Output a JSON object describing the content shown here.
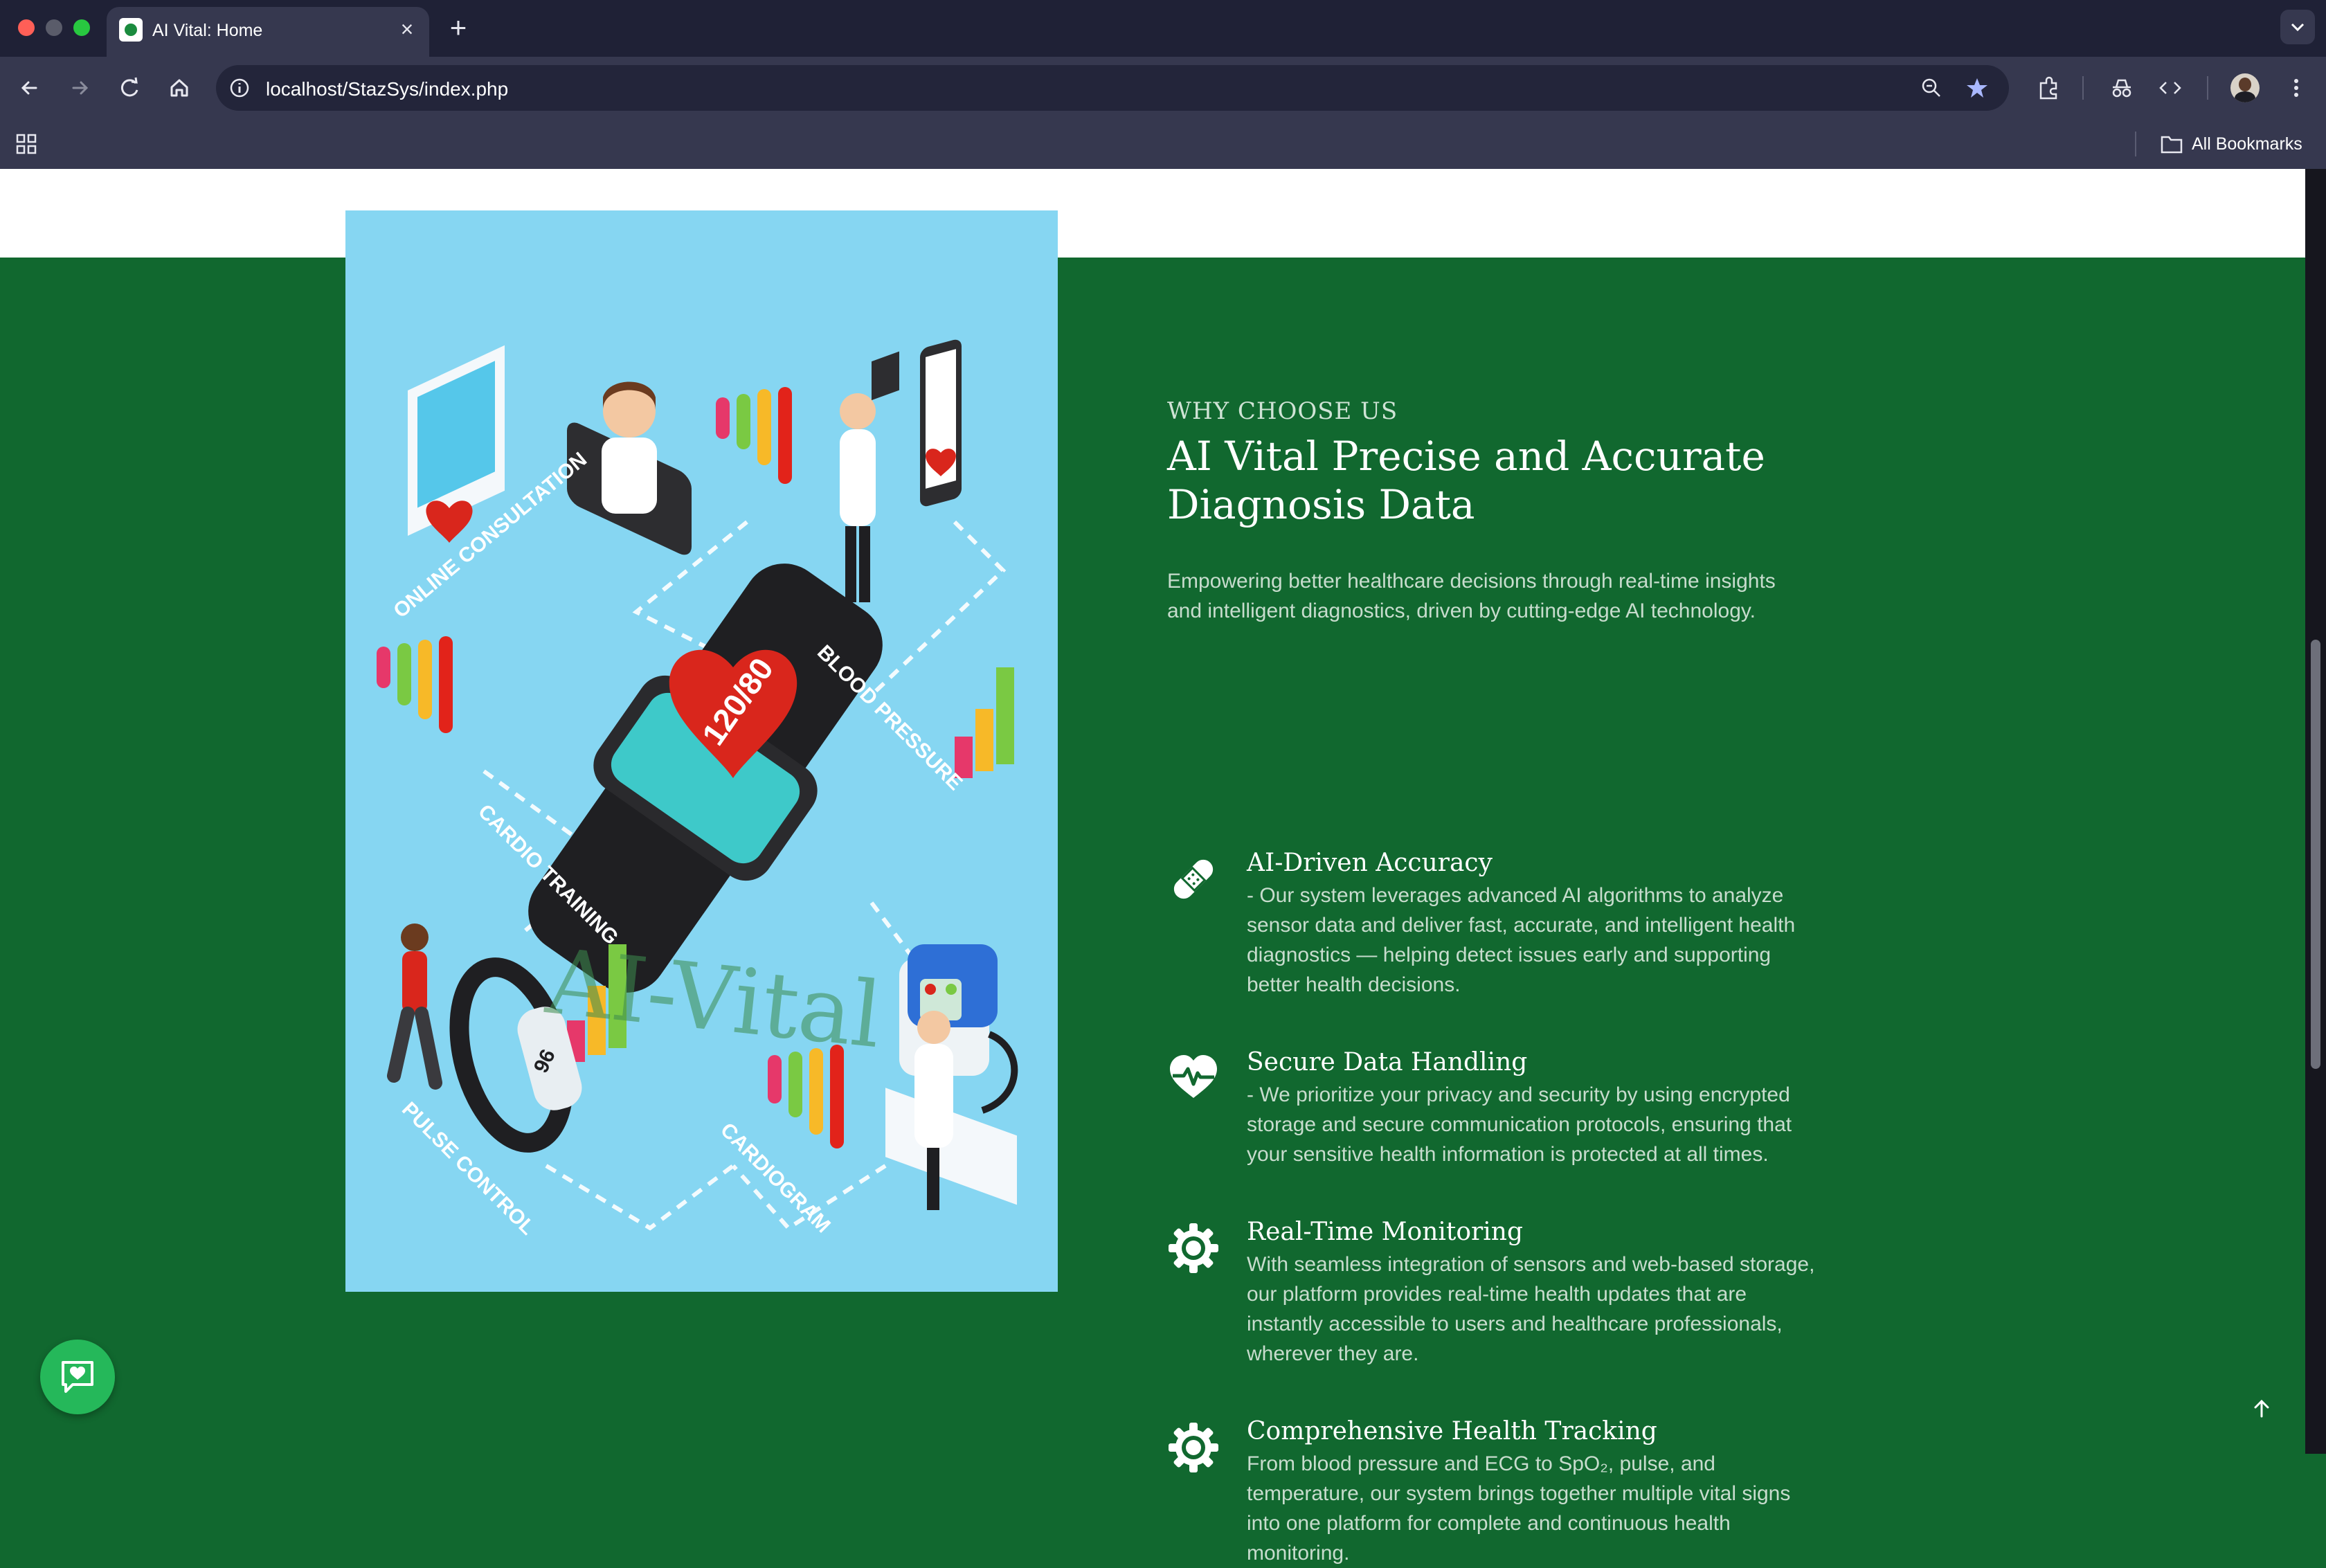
{
  "browser": {
    "tab_title": "AI Vital: Home",
    "url": "localhost/StazSys/index.php",
    "bookmarks_label": "All Bookmarks",
    "icons": [
      "back-icon",
      "forward-icon",
      "reload-icon",
      "home-icon",
      "info-icon",
      "zoom-icon",
      "star-icon",
      "extensions-icon",
      "incognito-icon",
      "devtools-icon",
      "avatar",
      "menu-icon",
      "apps-icon",
      "folder-icon"
    ]
  },
  "section": {
    "eyebrow": "WHY CHOOSE US",
    "headline_line1": "AI Vital Precise and Accurate",
    "headline_line2": "Diagnosis Data",
    "intro_line1": "Empowering better healthcare decisions through real-time insights",
    "intro_line2": "and intelligent diagnostics, driven by cutting-edge AI technology."
  },
  "illustration": {
    "labels": [
      "ONLINE CONSULTATION",
      "BLOOD PRESSURE",
      "CARDIO TRAINING",
      "PULSE CONTROL",
      "CARDIOGRAM"
    ],
    "watch_reading": "120/80",
    "band_reading": "96",
    "watermark": "AI-Vital"
  },
  "features": [
    {
      "icon": "bandage-icon",
      "title": "AI-Driven Accuracy",
      "lines": [
        "- Our system leverages advanced AI algorithms to analyze",
        "sensor data and deliver fast, accurate, and intelligent health",
        "diagnostics — helping detect issues early and supporting",
        "better health decisions."
      ]
    },
    {
      "icon": "heartbeat-icon",
      "title": "Secure Data Handling",
      "lines": [
        "- We prioritize your privacy and security by using encrypted",
        "storage and secure communication protocols, ensuring that",
        "your sensitive health information is protected at all times."
      ]
    },
    {
      "icon": "gear-icon",
      "title": "Real-Time Monitoring",
      "lines": [
        "With seamless integration of sensors and web-based storage,",
        "our platform provides real-time health updates that are",
        "instantly accessible to users and healthcare professionals,",
        "wherever they are."
      ]
    },
    {
      "icon": "gear-icon",
      "title": "Comprehensive Health Tracking",
      "lines": [
        "From blood pressure and ECG to SpO₂, pulse, and",
        "temperature, our system brings together multiple vital signs",
        "into one platform for complete and continuous health",
        "monitoring."
      ]
    }
  ],
  "colors": {
    "section_bg": "#11682f",
    "illustration_bg": "#86d6f2",
    "chat_button": "#25b85a",
    "browser_dark": "#1f2136",
    "browser_toolbar": "#36384f"
  }
}
